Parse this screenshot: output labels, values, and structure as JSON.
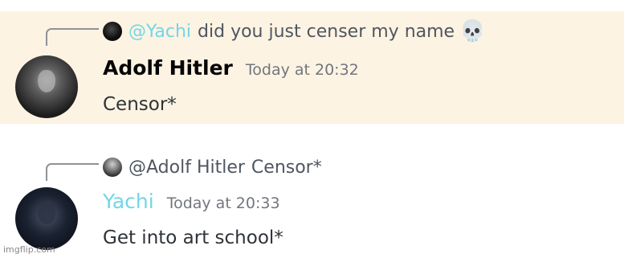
{
  "messages": [
    {
      "reply": {
        "mention": "@Yachi",
        "text": "did you just censer my name",
        "emoji": "skull"
      },
      "author": "Adolf Hitler",
      "timestamp": "Today at 20:32",
      "content": "Censor*",
      "highlighted": true
    },
    {
      "reply": {
        "mention": "@Adolf Hitler",
        "text": "Censor*"
      },
      "author": "Yachi",
      "timestamp": "Today at 20:33",
      "content": "Get into art school*",
      "highlighted": false
    }
  ],
  "colors": {
    "highlight_bg": "#fdf3e3",
    "yachi_name": "#73d6e6",
    "timestamp": "#72767d"
  },
  "icons": {
    "reply_emoji": "skull-emoji"
  },
  "watermark": "imgflip.com"
}
